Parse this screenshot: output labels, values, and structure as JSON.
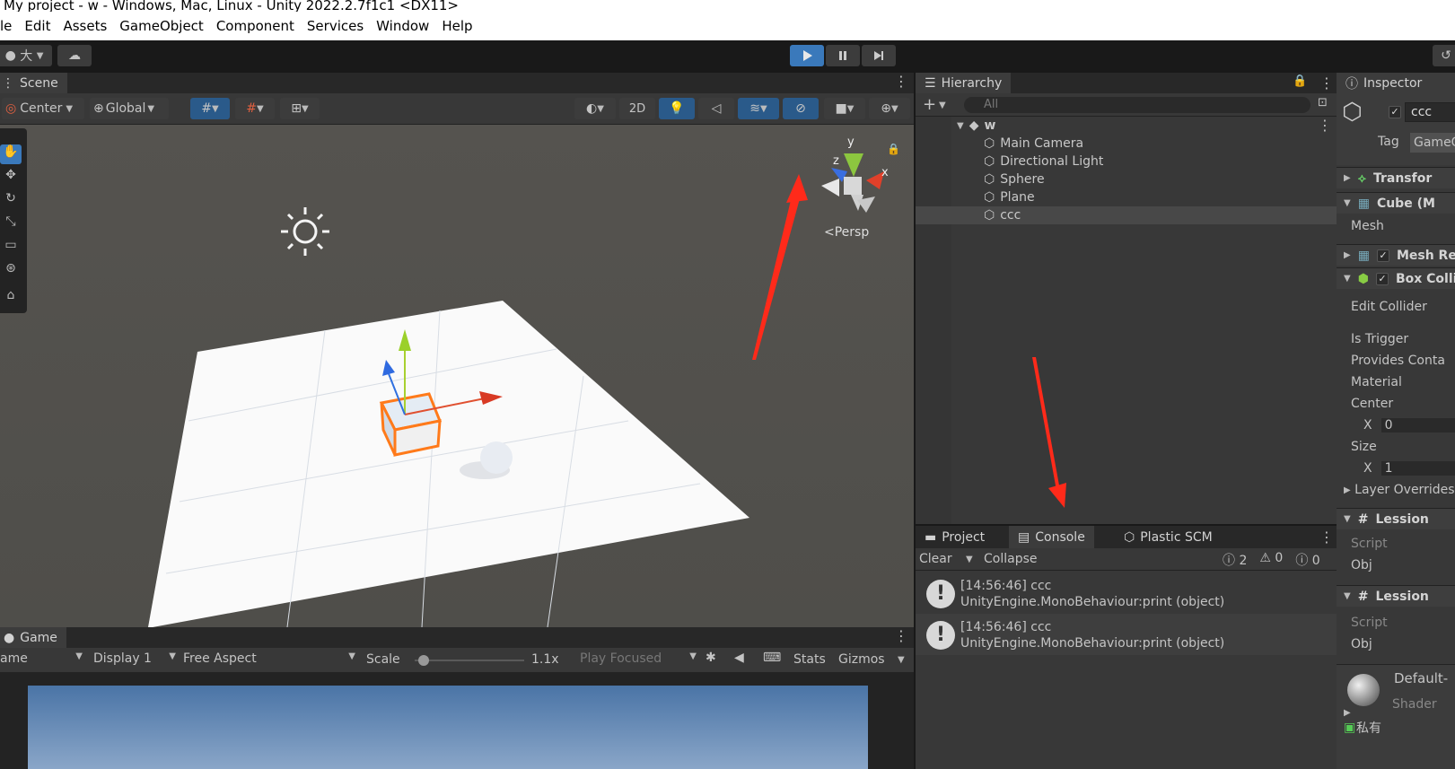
{
  "window": {
    "title": "My project - w - Windows, Mac, Linux - Unity 2022.2.7f1c1 <DX11>"
  },
  "menu": [
    "le",
    "Edit",
    "Assets",
    "GameObject",
    "Component",
    "Services",
    "Window",
    "Help"
  ],
  "toolbar": {
    "account_label": "大"
  },
  "scene": {
    "tab_label": "Scene",
    "pivot_label": "Center",
    "space_label": "Global",
    "mode_2d": "2D",
    "persp_label": "Persp",
    "gizmo_axes": {
      "y": "y",
      "z": "z",
      "x": "x"
    }
  },
  "game": {
    "tab_label": "Game",
    "view_label": "ame",
    "display_label": "Display 1",
    "aspect_label": "Free Aspect",
    "scale_label": "Scale",
    "scale_value": "1.1x",
    "play_focused": "Play Focused",
    "stats_label": "Stats",
    "gizmos_label": "Gizmos"
  },
  "hierarchy": {
    "tab_label": "Hierarchy",
    "search_placeholder": "All",
    "scene_name": "w",
    "items": [
      "Main Camera",
      "Directional Light",
      "Sphere",
      "Plane",
      "ccc"
    ],
    "selected": "ccc"
  },
  "console": {
    "tabs": [
      "Project",
      "Console",
      "Plastic SCM"
    ],
    "clear_label": "Clear",
    "collapse_label": "Collapse",
    "count_log": "2",
    "count_warn": "0",
    "count_error": "0",
    "entries": [
      {
        "line1": "[14:56:46] ccc",
        "line2": "UnityEngine.MonoBehaviour:print (object)"
      },
      {
        "line1": "[14:56:46] ccc",
        "line2": "UnityEngine.MonoBehaviour:print (object)"
      }
    ]
  },
  "inspector": {
    "tab_label": "Inspector",
    "object_name": "ccc",
    "tag_label": "Tag",
    "tag_value": "GameO",
    "transform_label": "Transfor",
    "mesh_filter_label": "Cube (M",
    "mesh_label": "Mesh",
    "mesh_renderer_label": "Mesh Re",
    "box_collider_label": "Box Colli",
    "edit_collider": "Edit Collider",
    "is_trigger": "Is Trigger",
    "provides_contacts": "Provides Conta",
    "material": "Material",
    "center": "Center",
    "center_x_label": "X",
    "center_x": "0",
    "size": "Size",
    "size_x_label": "X",
    "size_x": "1",
    "layer_overrides": "Layer Overrides",
    "script1_label": "Lession",
    "script_label": "Script",
    "obj_label": "Obj",
    "script2_label": "Lession",
    "script2_script": "Script",
    "script2_obj": "Obj",
    "material_name": "Default-",
    "shader_label": "Shader",
    "private_label": "私有"
  },
  "colors": {
    "accent": "#3a79bb",
    "annotation_arrow": "#ff2a1a",
    "panel_bg": "#383838",
    "toolbar_bg": "#191919"
  }
}
